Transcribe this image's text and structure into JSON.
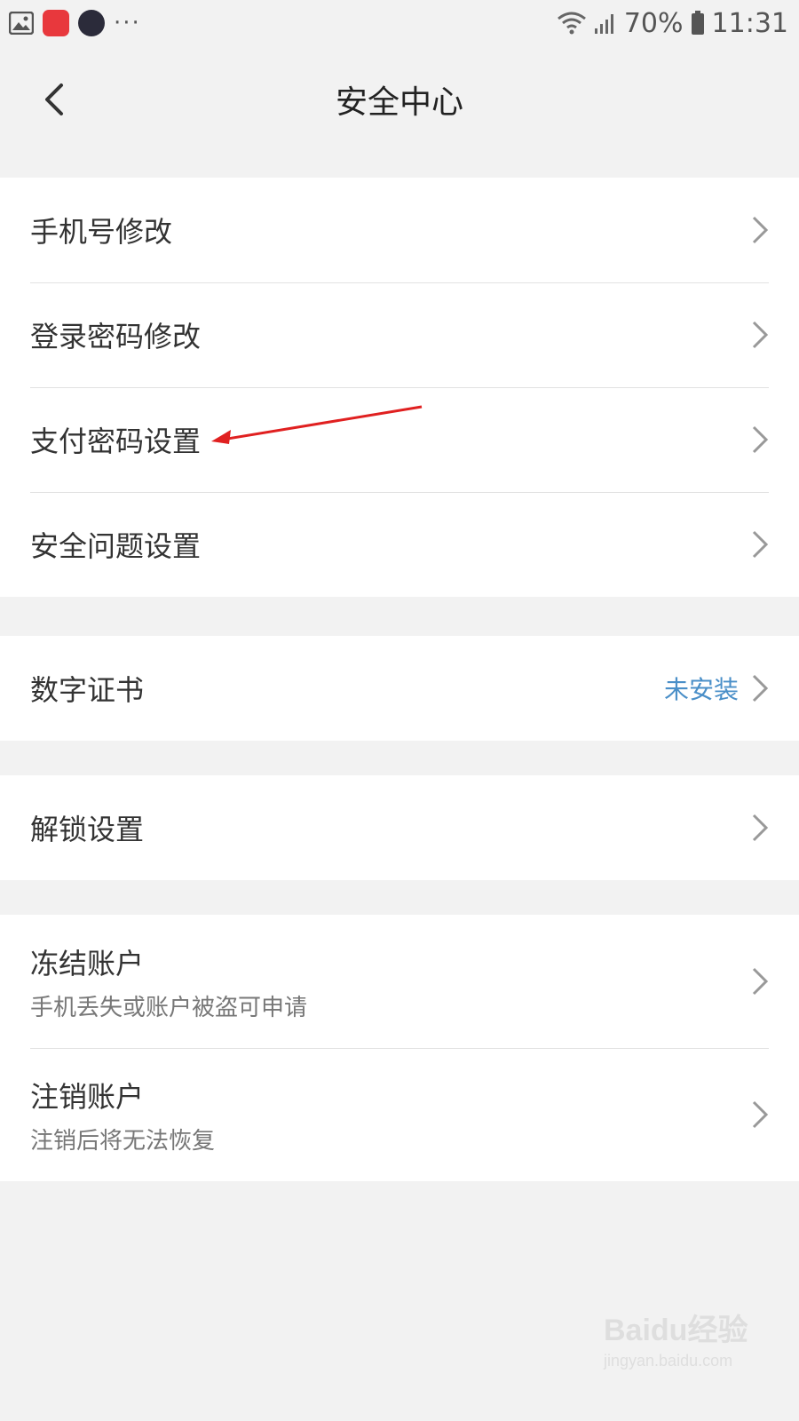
{
  "status_bar": {
    "battery": "70%",
    "time": "11:31",
    "more": "···"
  },
  "header": {
    "title": "安全中心",
    "back_icon": "chevron-left-icon"
  },
  "groups": [
    {
      "items": [
        {
          "label": "手机号修改"
        },
        {
          "label": "登录密码修改"
        },
        {
          "label": "支付密码设置"
        },
        {
          "label": "安全问题设置"
        }
      ]
    },
    {
      "items": [
        {
          "label": "数字证书",
          "status": "未安装"
        }
      ]
    },
    {
      "items": [
        {
          "label": "解锁设置"
        }
      ]
    },
    {
      "items": [
        {
          "label": "冻结账户",
          "sub": "手机丢失或账户被盗可申请"
        },
        {
          "label": "注销账户",
          "sub": "注销后将无法恢复"
        }
      ]
    }
  ],
  "watermark": {
    "text": "Baidu经验",
    "url": "jingyan.baidu.com"
  },
  "colors": {
    "background": "#f2f2f2",
    "status_link": "#4a8fc8",
    "annotation_arrow": "#e02020"
  }
}
